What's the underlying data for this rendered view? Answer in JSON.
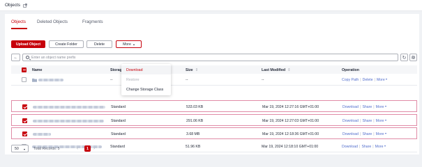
{
  "header": {
    "title": "Objects",
    "title_icon": "external-link-icon"
  },
  "tabs": [
    {
      "label": "Objects",
      "active": true
    },
    {
      "label": "Deleted Objects",
      "active": false
    },
    {
      "label": "Fragments",
      "active": false
    }
  ],
  "toolbar": {
    "upload_label": "Upload Object",
    "create_folder_label": "Create Folder",
    "delete_label": "Delete",
    "more_label": "More"
  },
  "more_menu": [
    {
      "label": "Download",
      "state": "hover"
    },
    {
      "label": "Restore",
      "state": "disabled"
    },
    {
      "label": "Change Storage Class",
      "state": "normal"
    }
  ],
  "search": {
    "placeholder": "Enter an object name prefix",
    "value": ""
  },
  "table": {
    "columns": {
      "name": "Name",
      "storage_class": "Storage",
      "size": "Size",
      "last_modified": "Last Modified",
      "operation": "Operation"
    },
    "rows": [
      {
        "selected": false,
        "storage_class": "--",
        "size": "--",
        "last_modified": "--",
        "ops": [
          "Copy Path",
          "Delete",
          "More"
        ]
      },
      {
        "selected": true,
        "storage_class": "Standard",
        "size": "533.03 KB",
        "last_modified": "Mar 19, 2024 12:27:16 GMT+01:00",
        "ops": [
          "Download",
          "Share",
          "More"
        ]
      },
      {
        "selected": true,
        "storage_class": "Standard",
        "size": "291.06 KB",
        "last_modified": "Mar 19, 2024 12:27:03 GMT+01:00",
        "ops": [
          "Download",
          "Share",
          "More"
        ]
      },
      {
        "selected": true,
        "storage_class": "Standard",
        "size": "3.68 MB",
        "last_modified": "Mar 19, 2024 12:18:36 GMT+01:00",
        "ops": [
          "Download",
          "Share",
          "More"
        ]
      },
      {
        "selected": false,
        "storage_class": "Standard",
        "size": "51.96 KB",
        "last_modified": "Mar 19, 2024 12:18:10 GMT+01:00",
        "ops": [
          "Download",
          "Share",
          "More"
        ]
      }
    ]
  },
  "pagination": {
    "page_size": "50",
    "total_label": "Total Records: 5",
    "current_page": "1",
    "prev_symbol": "‹",
    "next_symbol": "›"
  },
  "colors": {
    "accent": "#c7000b",
    "link": "#526ecc",
    "selected_border": "#e08ba6"
  }
}
